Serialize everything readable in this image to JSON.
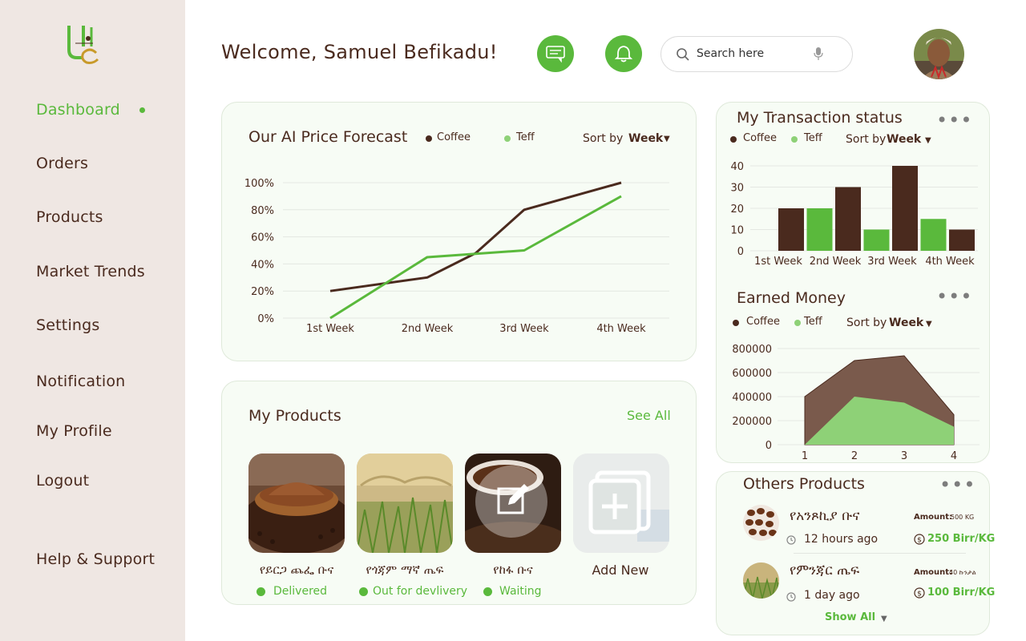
{
  "sidebar": {
    "items": [
      {
        "label": "Dashboard"
      },
      {
        "label": "Orders"
      },
      {
        "label": "Products"
      },
      {
        "label": "Market Trends"
      },
      {
        "label": "Settings"
      },
      {
        "label": "Notification"
      },
      {
        "label": "My Profile"
      },
      {
        "label": "Logout"
      },
      {
        "label": "Help & Support"
      }
    ]
  },
  "header": {
    "welcome": "Welcome, Samuel Befikadu!",
    "search_placeholder": "Search here",
    "icons": [
      "chat-icon",
      "bell-icon",
      "search-icon",
      "mic-icon"
    ]
  },
  "colors": {
    "accent": "#5ab93c",
    "coffee": "#4a2a1e",
    "teff": "#5ab93c",
    "sidebar_bg": "#efe7e3",
    "card_bg": "#f7fcf5"
  },
  "forecast": {
    "title": "Our AI Price Forecast",
    "sort_label": "Sort by",
    "sort_value": "Week"
  },
  "transactions": {
    "title": "My Transaction status",
    "sort_label": "Sort by",
    "sort_value": "Week"
  },
  "earned": {
    "title": "Earned Money",
    "sort_label": "Sort by",
    "sort_value": "Week"
  },
  "chart_data": [
    {
      "type": "line",
      "title": "Our AI Price Forecast",
      "categories": [
        "1st Week",
        "2nd Week",
        "3rd Week",
        "4th Week"
      ],
      "ylim": [
        0,
        100
      ],
      "yticks": [
        "0%",
        "20%",
        "40%",
        "60%",
        "80%",
        "100%"
      ],
      "legend": "top",
      "grid": true,
      "series": [
        {
          "name": "Coffee",
          "x": [
            1,
            2,
            2.5,
            3,
            4
          ],
          "values": [
            20,
            30,
            48,
            80,
            100
          ]
        },
        {
          "name": "Teff",
          "x": [
            1,
            2,
            3,
            4
          ],
          "values": [
            0,
            45,
            50,
            90
          ]
        }
      ]
    },
    {
      "type": "bar",
      "title": "My Transaction status",
      "categories": [
        "1st Week",
        "2nd Week",
        "3rd Week",
        "4th Week"
      ],
      "ylim": [
        0,
        40
      ],
      "yticks": [
        "0",
        "10",
        "20",
        "30",
        "40"
      ],
      "legend": "top",
      "grid": true,
      "bars": [
        {
          "series": "Coffee",
          "value": 20
        },
        {
          "series": "Teff",
          "value": 20
        },
        {
          "series": "Coffee",
          "value": 30
        },
        {
          "series": "Teff",
          "value": 10
        },
        {
          "series": "Coffee",
          "value": 40
        },
        {
          "series": "Teff",
          "value": 15
        },
        {
          "series": "Coffee",
          "value": 10
        }
      ]
    },
    {
      "type": "area",
      "title": "Earned Money",
      "categories": [
        "1",
        "2",
        "3",
        "4"
      ],
      "ylim": [
        0,
        800000
      ],
      "yticks": [
        "0",
        "200000",
        "400000",
        "600000",
        "800000"
      ],
      "legend": "top",
      "grid": true,
      "series": [
        {
          "name": "Coffee",
          "values": [
            400000,
            700000,
            740000,
            250000
          ]
        },
        {
          "name": "Teff",
          "values": [
            0,
            400000,
            350000,
            150000
          ]
        }
      ]
    }
  ],
  "products": {
    "title": "My Products",
    "see_all": "See All",
    "items": [
      {
        "name": "የይርጋ ጨፌ ቡና",
        "status": "Delivered"
      },
      {
        "name": "የጎጃም ማኛ ጤፍ",
        "status": "Out for devlivery"
      },
      {
        "name": "የከፋ ቡና",
        "status": "Waiting"
      },
      {
        "name": "Add New",
        "status": ""
      }
    ]
  },
  "others": {
    "title": "Others Products",
    "show_all": "Show All",
    "items": [
      {
        "name": "የአንጾኪያ ቡና",
        "amount_label": "Amount:",
        "amount": "500 KG",
        "time": "12 hours ago",
        "price": "250 Birr/KG"
      },
      {
        "name": "የምንጃር ጤፍ",
        "amount_label": "Amount:",
        "amount": "40 ኩንታል",
        "time": "1 day ago",
        "price": "100 Birr/KG"
      }
    ]
  }
}
